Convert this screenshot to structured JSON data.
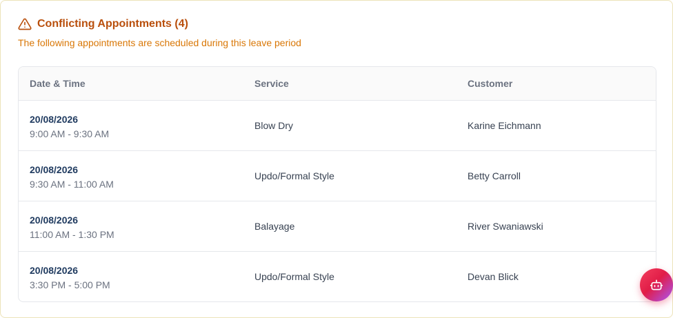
{
  "header": {
    "title": "Conflicting Appointments (4)",
    "subtitle": "The following appointments are scheduled during this leave period"
  },
  "table": {
    "columns": [
      "Date & Time",
      "Service",
      "Customer"
    ],
    "rows": [
      {
        "date": "20/08/2026",
        "time": "9:00 AM - 9:30 AM",
        "service": "Blow Dry",
        "customer": "Karine Eichmann"
      },
      {
        "date": "20/08/2026",
        "time": "9:30 AM - 11:00 AM",
        "service": "Updo/Formal Style",
        "customer": "Betty Carroll"
      },
      {
        "date": "20/08/2026",
        "time": "11:00 AM - 1:30 PM",
        "service": "Balayage",
        "customer": "River Swaniawski"
      },
      {
        "date": "20/08/2026",
        "time": "3:30 PM - 5:00 PM",
        "service": "Updo/Formal Style",
        "customer": "Devan Blick"
      }
    ]
  },
  "icons": {
    "warning": "warning-triangle-icon",
    "assistant": "robot-icon"
  },
  "colors": {
    "title": "#b94f0c",
    "subtitle": "#d97706",
    "fab_gradient_start": "#f43f5e",
    "fab_gradient_end": "#a855f7"
  }
}
